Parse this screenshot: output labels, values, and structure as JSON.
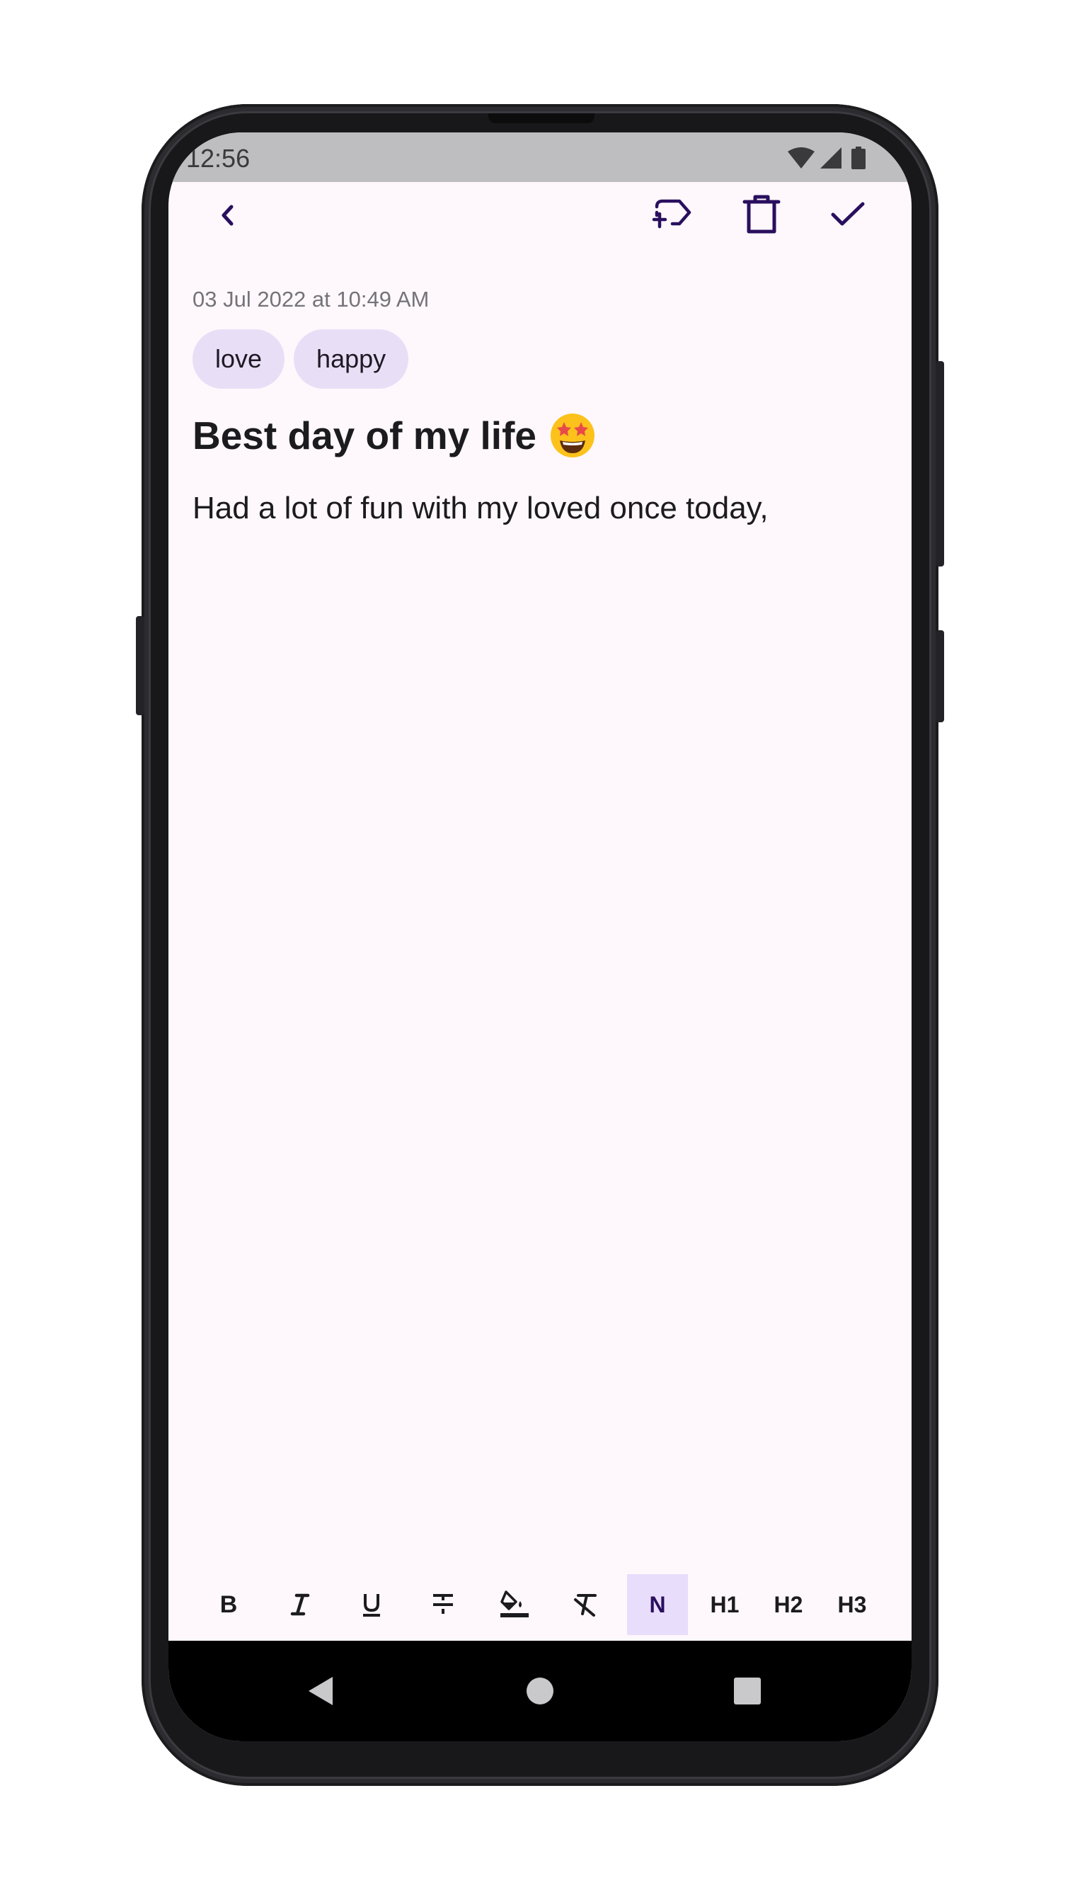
{
  "status_bar": {
    "time": "12:56",
    "icons": [
      "wifi-icon",
      "signal-icon",
      "battery-icon"
    ]
  },
  "toolbar": {
    "icons": [
      "back-icon",
      "add-tag-icon",
      "delete-icon",
      "save-check-icon"
    ]
  },
  "note": {
    "date": "03 Jul 2022 at 10:49 AM",
    "tags": [
      "love",
      "happy"
    ],
    "title": "Best day of my life",
    "title_emoji": "🤩",
    "body": "Had a lot of fun with my loved once today,"
  },
  "format_bar": {
    "buttons": [
      "B",
      "I",
      "U",
      "strikethrough",
      "fill-color",
      "clear-format"
    ],
    "headings": [
      "N",
      "H1",
      "H2",
      "H3"
    ],
    "active": "N"
  },
  "nav_bar": {
    "icons": [
      "nav-back-icon",
      "nav-home-icon",
      "nav-recents-icon"
    ]
  },
  "colors": {
    "accent": "#2a0f5e",
    "tag_bg": "#e8dff7",
    "screen_bg": "#fef8fc"
  }
}
